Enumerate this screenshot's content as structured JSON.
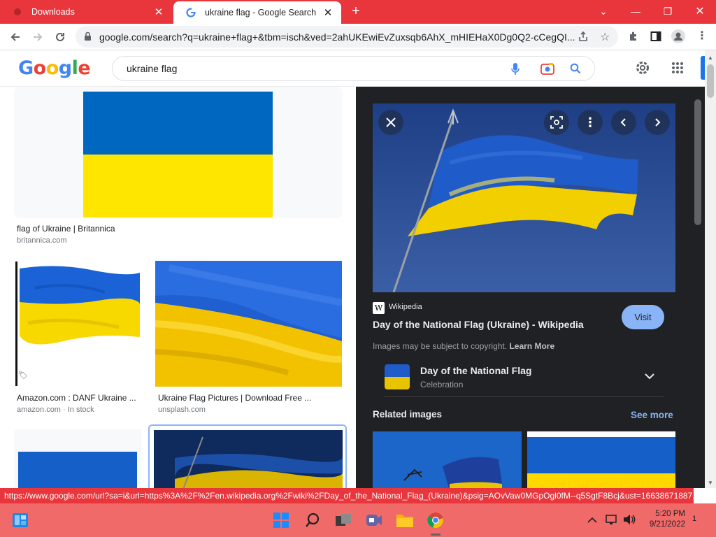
{
  "browser": {
    "tabs": [
      {
        "title": "Downloads"
      },
      {
        "title": "ukraine flag - Google Search"
      }
    ],
    "new_tab": "+",
    "url": "google.com/search?q=ukraine+flag+&tbm=isch&ved=2ahUKEwiEvZuxsqb6AhX_mHIEHaX0Dg0Q2-cCegQI..."
  },
  "google": {
    "logo": [
      "G",
      "o",
      "o",
      "g",
      "l",
      "e"
    ],
    "logo_colors": [
      "#4285f4",
      "#ea4335",
      "#fbbc05",
      "#4285f4",
      "#34a853",
      "#ea4335"
    ],
    "query": "ukraine flag"
  },
  "results": [
    {
      "title": "flag of Ukraine | Britannica",
      "source": "britannica.com"
    },
    {
      "title": "Amazon.com : DANF Ukraine ...",
      "source": "amazon.com · In stock"
    },
    {
      "title": "Ukraine Flag Pictures | Download Free ...",
      "source": "unsplash.com"
    }
  ],
  "preview": {
    "site": "Wikipedia",
    "site_badge": "W",
    "title": "Day of the National Flag (Ukraine) - Wikipedia",
    "visit": "Visit",
    "copyright": "Images may be subject to copyright.",
    "learn_more": "Learn More",
    "entity": {
      "name": "Day of the National Flag",
      "type": "Celebration"
    },
    "related_heading": "Related images",
    "see_more": "See more"
  },
  "status_url": "https://www.google.com/url?sa=i&url=https%3A%2F%2Fen.wikipedia.org%2Fwiki%2FDay_of_the_National_Flag_(Ukraine)&psig=AOvVaw0MGpOgl0fM--q5SgtF8Bcj&ust=16638671887...",
  "taskbar": {
    "time": "5:20 PM",
    "date": "9/21/2022",
    "notifications": "1"
  },
  "colors": {
    "flag_blue": "#0057b7",
    "flag_yellow": "#ffd700",
    "accent": "#e8363c"
  }
}
